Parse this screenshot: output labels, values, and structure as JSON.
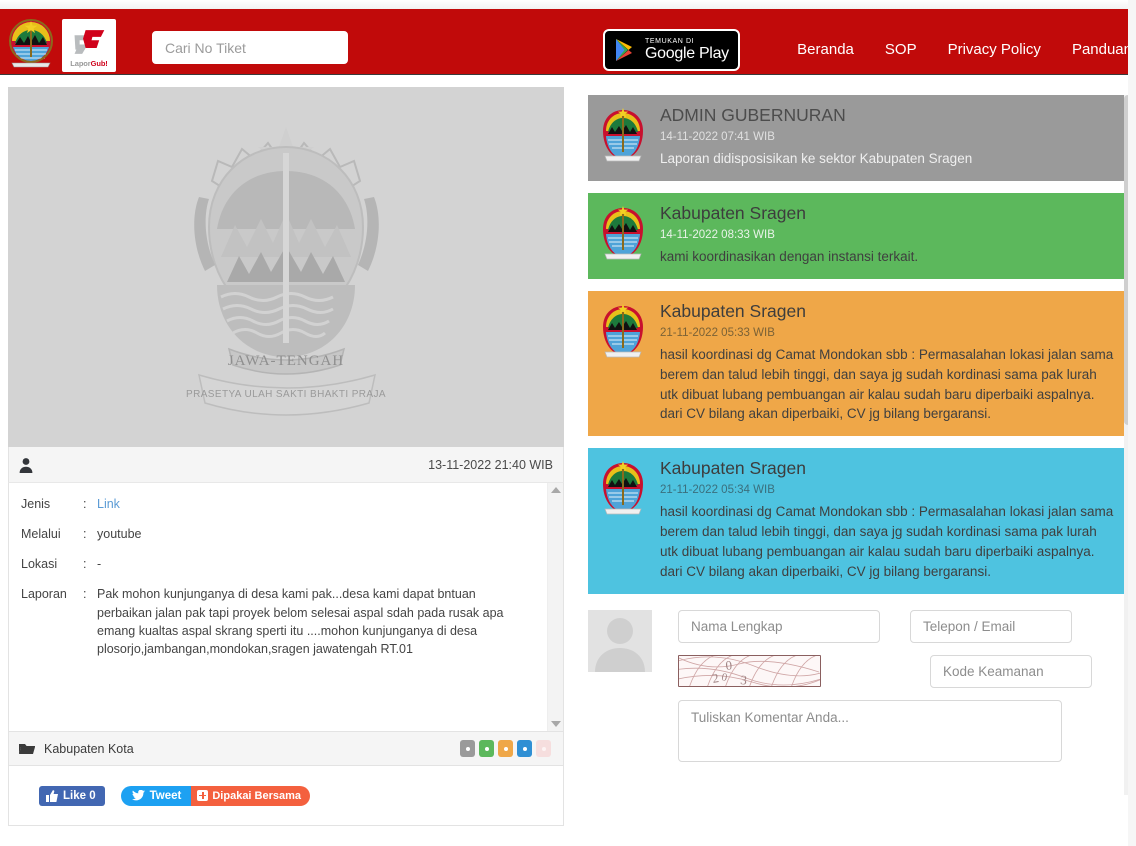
{
  "header": {
    "logo_alt": "Jawa Tengah Emblem",
    "brand_name": "LaporGub!",
    "brand_prefix": "Lapor",
    "brand_suffix": "Gub!",
    "search_placeholder": "Cari No Tiket",
    "search_value": "",
    "gplay_top": "TEMUKAN DI",
    "gplay_bottom": "Google Play",
    "nav": [
      {
        "label": "Beranda"
      },
      {
        "label": "SOP"
      },
      {
        "label": "Privacy Policy"
      },
      {
        "label": "Panduan"
      }
    ],
    "bg_color": "#c10a0a"
  },
  "report": {
    "image_caption": "JAWA-TENGAH",
    "motto": "PRASETYA ULAH SAKTI BHAKTI PRAJA",
    "date": "13-11-2022 21:40 WIB",
    "fields": [
      {
        "label": "Jenis",
        "colon": ":",
        "value": "Link",
        "is_link": true
      },
      {
        "label": "Melalui",
        "colon": ":",
        "value": "youtube",
        "is_link": false
      },
      {
        "label": "Lokasi",
        "colon": ":",
        "value": "-",
        "is_link": false
      },
      {
        "label": "Laporan",
        "colon": ":",
        "value": "Pak mohon kunjunganya di desa kami pak...desa kami dapat bntuan perbaikan jalan pak tapi proyek belom selesai aspal sdah pada rusak apa emang kualtas aspal skrang sperti itu ....mohon kunjunganya di desa plosorjo,jambangan,mondokan,sragen jawatengah RT.01",
        "is_link": false
      }
    ],
    "category": "Kabupaten Kota",
    "status_dots": [
      {
        "name": "status-gray",
        "color": "#9a9a9a"
      },
      {
        "name": "status-green",
        "color": "#5cb85c"
      },
      {
        "name": "status-orange",
        "color": "#efa748"
      },
      {
        "name": "status-blue",
        "color": "#2f8fd4"
      },
      {
        "name": "status-pink",
        "color": "#f6dede"
      }
    ]
  },
  "social": {
    "facebook_label": "Like 0",
    "twitter_label": "Tweet",
    "share_label": "Dipakai Bersama"
  },
  "comments": [
    {
      "author": "ADMIN GUBERNURAN",
      "time": "14-11-2022 07:41 WIB",
      "text": "Laporan didisposisikan ke sektor Kabupaten Sragen",
      "color_class": "gray",
      "color": "#9a9a9a"
    },
    {
      "author": "Kabupaten Sragen",
      "time": "14-11-2022 08:33 WIB",
      "text": "kami koordinasikan dengan instansi terkait.",
      "color_class": "green",
      "color": "#5cb85c"
    },
    {
      "author": "Kabupaten Sragen",
      "time": "21-11-2022 05:33 WIB",
      "text": "hasil koordinasi dg Camat Mondokan sbb : Permasalahan lokasi jalan sama berem dan talud lebih tinggi, dan saya jg sudah kordinasi sama pak lurah utk dibuat lubang pembuangan air kalau sudah baru diperbaiki aspalnya. dari CV bilang akan diperbaiki, CV jg bilang bergaransi.",
      "color_class": "orange",
      "color": "#efa748"
    },
    {
      "author": "Kabupaten Sragen",
      "time": "21-11-2022 05:34 WIB",
      "text": "hasil koordinasi dg Camat Mondokan sbb : Permasalahan lokasi jalan sama berem dan talud lebih tinggi, dan saya jg sudah kordinasi sama pak lurah utk dibuat lubang pembuangan air kalau sudah baru diperbaiki aspalnya. dari CV bilang akan diperbaiki, CV jg bilang bergaransi.",
      "color_class": "blue",
      "color": "#4ec3e0"
    }
  ],
  "comment_form": {
    "name_placeholder": "Nama Lengkap",
    "name_value": "",
    "phone_placeholder": "Telepon / Email",
    "phone_value": "",
    "code_placeholder": "Kode Keamanan",
    "code_value": "",
    "comment_placeholder": "Tuliskan Komentar Anda...",
    "comment_value": "",
    "captcha_text": "2003"
  }
}
